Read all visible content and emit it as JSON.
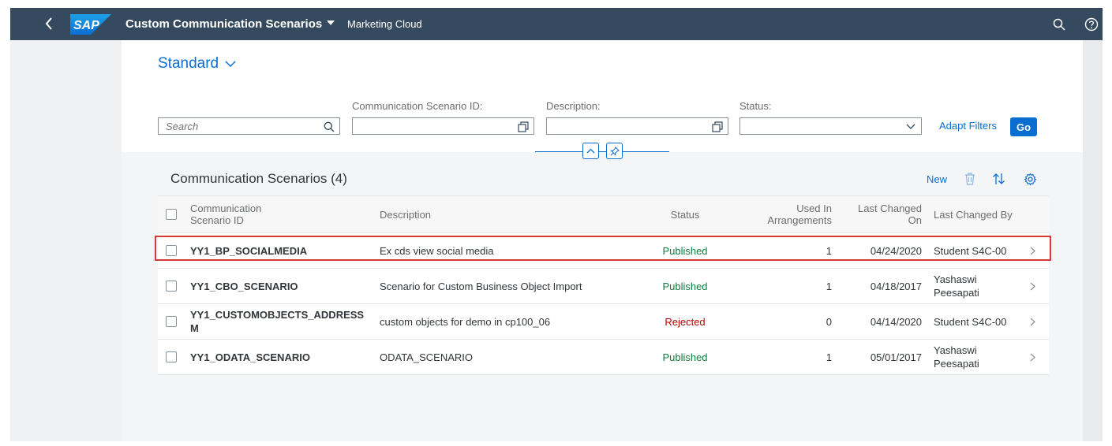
{
  "shell": {
    "logo_text": "SAP",
    "app_title": "Custom Communication Scenarios",
    "subtitle": "Marketing Cloud",
    "icons": [
      "back-icon",
      "search-icon",
      "help-icon"
    ],
    "bar_color": "#354a5f"
  },
  "filters": {
    "variant": "Standard",
    "search_placeholder": "Search",
    "id_label": "Communication Scenario ID:",
    "id_value": "",
    "desc_label": "Description:",
    "desc_value": "",
    "status_label": "Status:",
    "status_value": "",
    "adapt_filters": "Adapt Filters",
    "go": "Go"
  },
  "table": {
    "title": "Communication Scenarios (4)",
    "toolbar": {
      "new": "New",
      "icons": [
        "delete-icon",
        "sort-icon",
        "settings-icon"
      ]
    },
    "columns": {
      "id_1": "Communication",
      "id_2": "Scenario ID",
      "description": "Description",
      "status": "Status",
      "used_1": "Used In",
      "used_2": "Arrangements",
      "changed_on_1": "Last Changed",
      "changed_on_2": "On",
      "changed_by": "Last Changed By"
    },
    "rows": [
      {
        "id": "YY1_BP_SOCIALMEDIA",
        "id_2": "",
        "description": "Ex cds view social media",
        "status": "Published",
        "used": "1",
        "changed_on": "04/24/2020",
        "changed_by_1": "Student S4C-00",
        "changed_by_2": ""
      },
      {
        "id": "YY1_CBO_SCENARIO",
        "id_2": "",
        "description": "Scenario for Custom Business Object Import",
        "status": "Published",
        "used": "1",
        "changed_on": "04/18/2017",
        "changed_by_1": "Yashaswi",
        "changed_by_2": "Peesapati"
      },
      {
        "id": "YY1_CUSTOMOBJECTS_ADDRESS",
        "id_2": "M",
        "description": "custom objects for demo in cp100_06",
        "status": "Rejected",
        "used": "0",
        "changed_on": "04/14/2020",
        "changed_by_1": "Student S4C-00",
        "changed_by_2": ""
      },
      {
        "id": "YY1_ODATA_SCENARIO",
        "id_2": "",
        "description": "ODATA_SCENARIO",
        "status": "Published",
        "used": "1",
        "changed_on": "05/01/2017",
        "changed_by_1": "Yashaswi",
        "changed_by_2": "Peesapati"
      }
    ]
  },
  "colors": {
    "accent": "#0a6ed1",
    "published": "#107e3e",
    "rejected": "#bb0000",
    "highlight": "#d9383a"
  }
}
